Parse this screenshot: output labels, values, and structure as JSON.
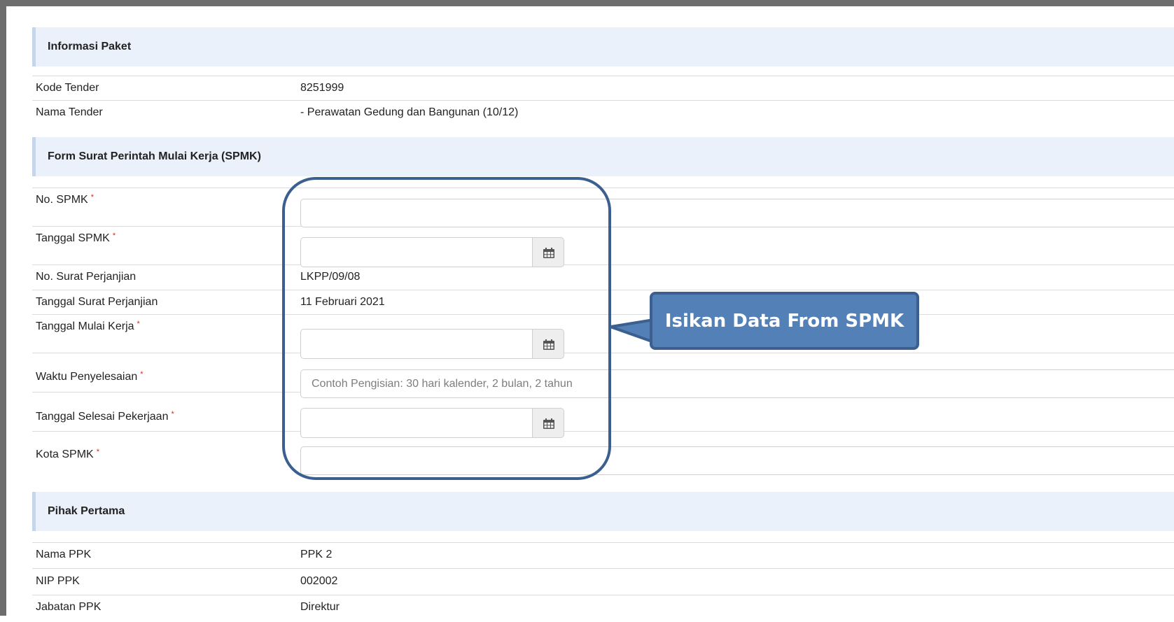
{
  "sections": {
    "paket": {
      "title": "Informasi Paket"
    },
    "spmk": {
      "title": "Form Surat Perintah Mulai Kerja (SPMK)"
    },
    "pihak": {
      "title": "Pihak Pertama"
    }
  },
  "paket": {
    "kode_tender": {
      "label": "Kode Tender",
      "value": "8251999"
    },
    "nama_tender": {
      "label": "Nama Tender",
      "value": "- Perawatan Gedung dan Bangunan (10/12)"
    }
  },
  "form": {
    "required_mark": "*",
    "no_spmk": {
      "label": "No. SPMK",
      "value": ""
    },
    "tanggal_spmk": {
      "label": "Tanggal SPMK",
      "value": ""
    },
    "no_surat_perjanjian": {
      "label": "No. Surat Perjanjian",
      "value": "LKPP/09/08"
    },
    "tanggal_surat_perjanjian": {
      "label": "Tanggal Surat Perjanjian",
      "value": "11 Februari 2021"
    },
    "tanggal_mulai_kerja": {
      "label": "Tanggal Mulai Kerja",
      "value": ""
    },
    "waktu_penyelesaian": {
      "label": "Waktu Penyelesaian",
      "value": "",
      "placeholder": "Contoh Pengisian: 30 hari kalender, 2 bulan, 2 tahun"
    },
    "tanggal_selesai_pekerjaan": {
      "label": "Tanggal Selesai Pekerjaan",
      "value": ""
    },
    "kota_spmk": {
      "label": "Kota SPMK",
      "value": ""
    }
  },
  "pihak": {
    "nama_ppk": {
      "label": "Nama PPK",
      "value": "PPK 2"
    },
    "nip_ppk": {
      "label": "NIP PPK",
      "value": "002002"
    },
    "jabatan_ppk": {
      "label": "Jabatan PPK",
      "value": "Direktur"
    }
  },
  "callout": {
    "text": "Isikan Data From SPMK"
  },
  "icons": {
    "calendar": "calendar-icon"
  },
  "colors": {
    "section_bg": "#eaf1fa",
    "required": "#d9261c",
    "callout_bg": "#5480b8",
    "callout_border": "#3b5f8e"
  }
}
